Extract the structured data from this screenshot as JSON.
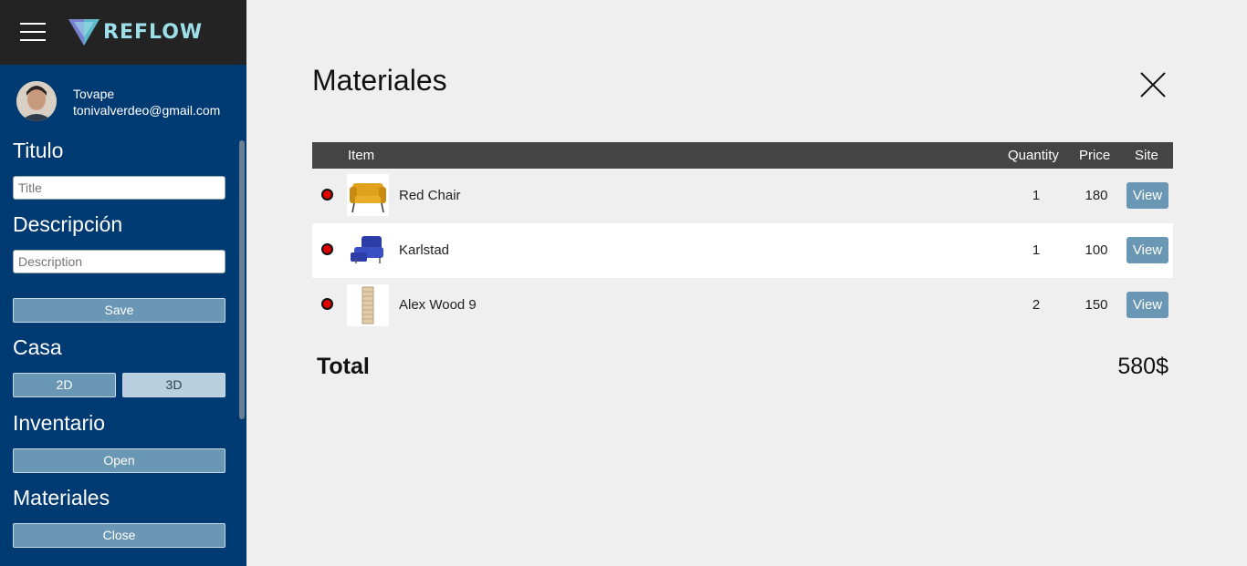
{
  "app": {
    "logo_text": "REFLOW"
  },
  "user": {
    "name": "Tovape",
    "email": "tonivalverdeo@gmail.com"
  },
  "sidebar": {
    "titulo_label": "Titulo",
    "title_placeholder": "Title",
    "descripcion_label": "Descripción",
    "description_placeholder": "Description",
    "save_label": "Save",
    "casa_label": "Casa",
    "btn_2d": "2D",
    "btn_3d": "3D",
    "inventario_label": "Inventario",
    "open_label": "Open",
    "materiales_label": "Materiales",
    "close_label": "Close"
  },
  "main": {
    "title": "Materiales",
    "columns": {
      "item": "Item",
      "quantity": "Quantity",
      "price": "Price",
      "site": "Site"
    },
    "rows": [
      {
        "name": "Red Chair",
        "quantity": "1",
        "price": "180",
        "view": "View"
      },
      {
        "name": "Karlstad",
        "quantity": "1",
        "price": "100",
        "view": "View"
      },
      {
        "name": "Alex Wood 9",
        "quantity": "2",
        "price": "150",
        "view": "View"
      }
    ],
    "total_label": "Total",
    "total_value": "580$"
  },
  "colors": {
    "sidebar": "#003a73",
    "topbar": "#232323",
    "accent_button": "#6a97b4",
    "status_dot": "#e10000"
  }
}
